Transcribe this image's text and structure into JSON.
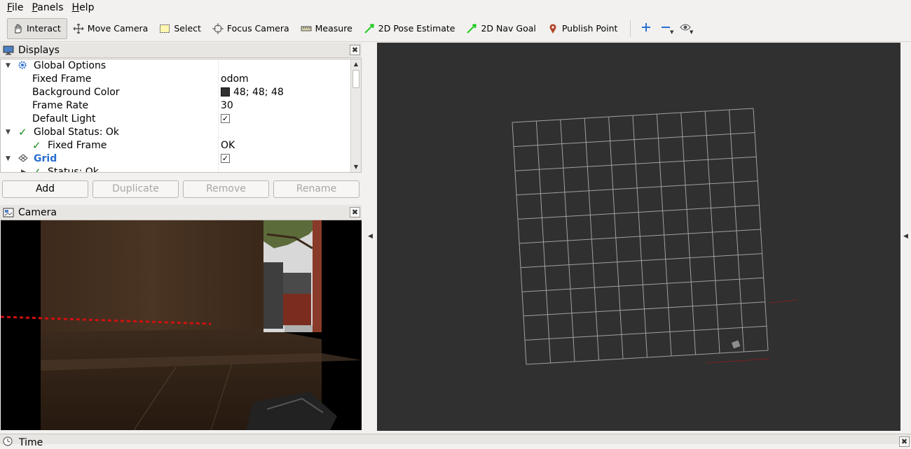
{
  "menubar": {
    "items": [
      {
        "label": "File",
        "accel": "F",
        "rest": "ile"
      },
      {
        "label": "Panels",
        "accel": "P",
        "rest": "anels"
      },
      {
        "label": "Help",
        "accel": "H",
        "rest": "elp"
      }
    ]
  },
  "toolbar": {
    "interact": "Interact",
    "move_camera": "Move Camera",
    "select": "Select",
    "focus_camera": "Focus Camera",
    "measure": "Measure",
    "pose_estimate": "2D Pose Estimate",
    "nav_goal": "2D Nav Goal",
    "publish_point": "Publish Point"
  },
  "displays": {
    "title": "Displays",
    "rows": {
      "global_options": "Global Options",
      "fixed_frame": {
        "label": "Fixed Frame",
        "value": "odom"
      },
      "background_color": {
        "label": "Background Color",
        "value": "48; 48; 48",
        "color": "#303030"
      },
      "frame_rate": {
        "label": "Frame Rate",
        "value": "30"
      },
      "default_light": {
        "label": "Default Light",
        "checked": true
      },
      "global_status": "Global Status: Ok",
      "status_fixed_frame": {
        "label": "Fixed Frame",
        "value": "OK"
      },
      "grid": {
        "label": "Grid",
        "checked": true
      },
      "grid_status": "Status: Ok"
    },
    "buttons": {
      "add": "Add",
      "duplicate": "Duplicate",
      "remove": "Remove",
      "rename": "Rename"
    }
  },
  "camera": {
    "title": "Camera"
  },
  "viewport": {
    "background": "#303030",
    "grid_color": "#a0a0a0"
  },
  "time": {
    "title": "Time"
  },
  "colors": {
    "accent_blue": "#2a6fcf",
    "ok_green": "#1d8a1d",
    "pose_green": "#22cc22",
    "marker_red": "#c0392b"
  }
}
